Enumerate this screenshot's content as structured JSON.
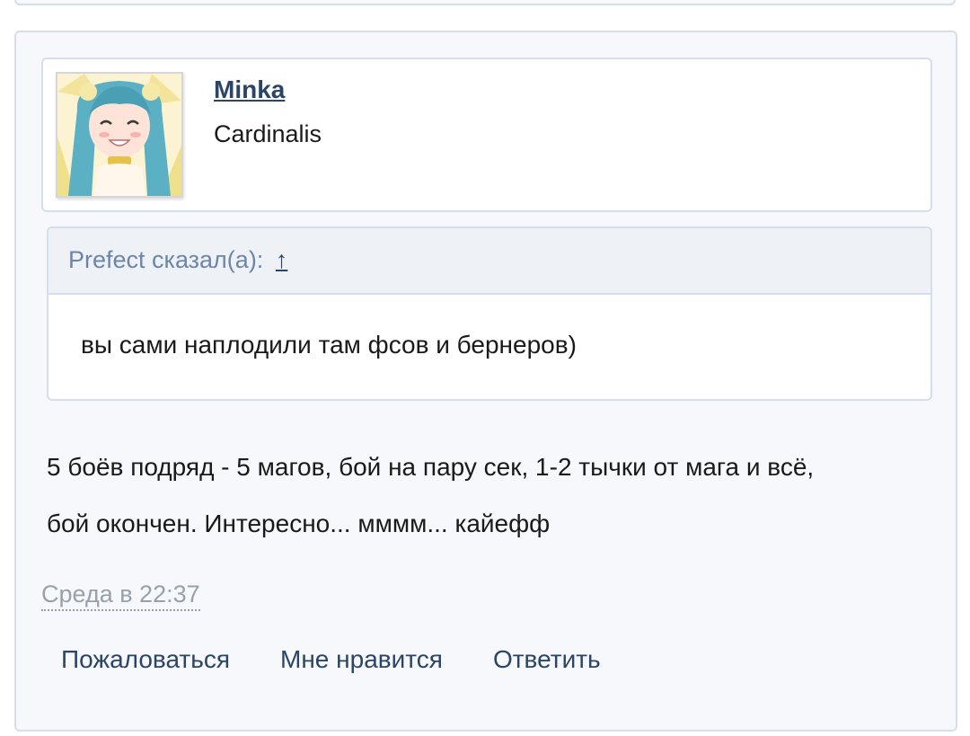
{
  "post": {
    "author": {
      "name": "Minka",
      "title": "Cardinalis"
    },
    "quote": {
      "header": "Prefect сказал(а):",
      "jump_glyph": "↑",
      "text": "вы сами наплодили там фсов и бернеров)"
    },
    "message_lines": [
      "5 боёв подряд - 5 магов, бой на пару сек, 1-2 тычки от мага и всё,",
      "бой окончен. Интересно... мммм... кайефф"
    ],
    "timestamp": "Среда в 22:37",
    "actions": {
      "report": "Пожаловаться",
      "like": "Мне нравится",
      "reply": "Ответить"
    }
  },
  "colors": {
    "link": "#2a4566",
    "quote_header_text": "#6d86a8",
    "border": "#d4dfeb",
    "post_background": "#f6f8fb"
  },
  "icons": {
    "avatar": "anime-girl-avatar",
    "quote_jump": "arrow-up-icon"
  }
}
